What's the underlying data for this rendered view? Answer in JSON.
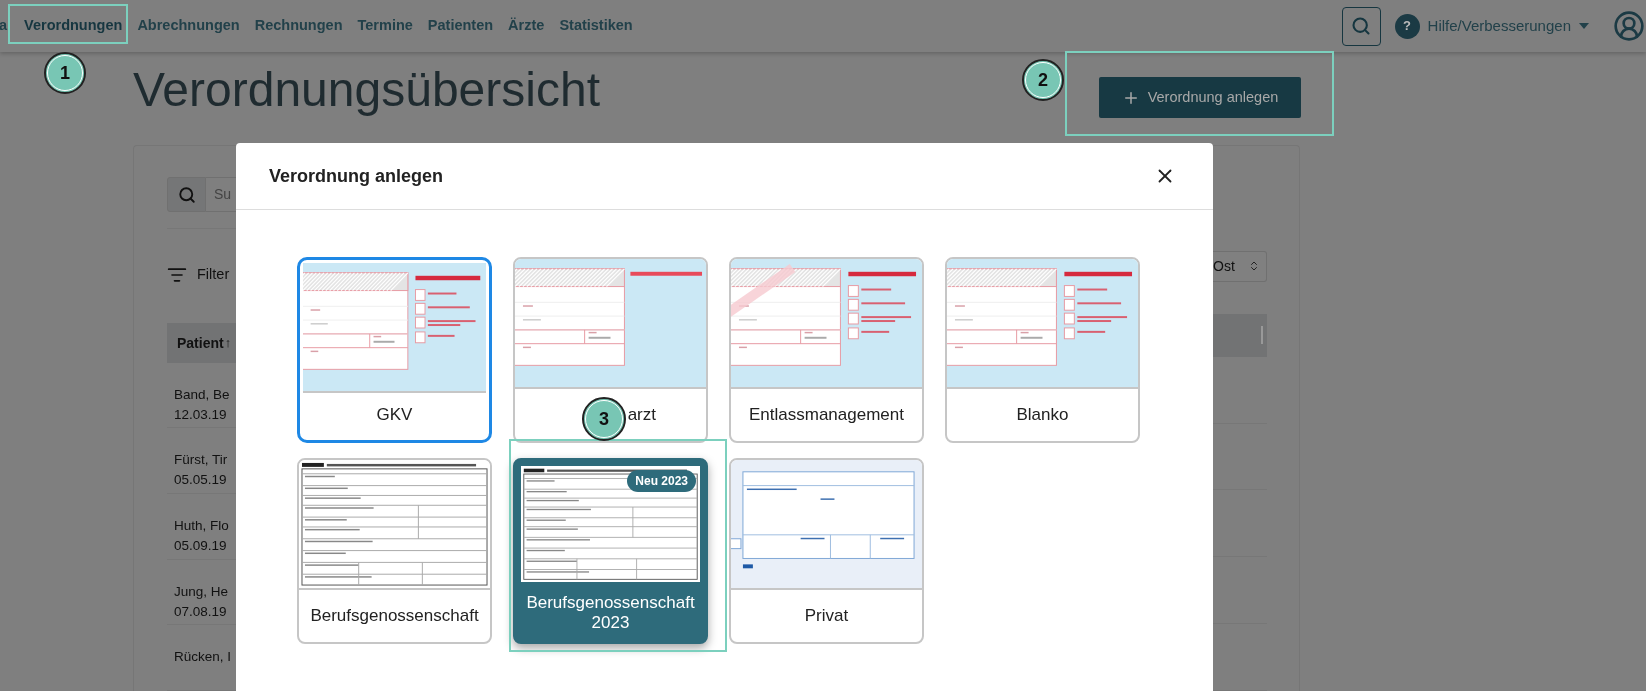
{
  "nav": {
    "items": [
      {
        "label": "a",
        "selected": false
      },
      {
        "label": "Verordnungen",
        "selected": true
      },
      {
        "label": "Abrechnungen",
        "selected": false
      },
      {
        "label": "Rechnungen",
        "selected": false
      },
      {
        "label": "Termine",
        "selected": false
      },
      {
        "label": "Patienten",
        "selected": false
      },
      {
        "label": "Ärzte",
        "selected": false
      },
      {
        "label": "Statistiken",
        "selected": false
      }
    ],
    "help": {
      "badge": "?",
      "label": "Hilfe/Verbesserungen"
    }
  },
  "page": {
    "title": "Verordnungsübersicht",
    "create_button": "Verordnung anlegen"
  },
  "search": {
    "placeholder": "Su"
  },
  "filter": {
    "label": "Filter"
  },
  "sort": {
    "value": "Ost"
  },
  "table": {
    "columns": [
      {
        "label": "Patient",
        "sort_arrow": "↑"
      }
    ],
    "rows": [
      {
        "name": "Band, Be",
        "date": "12.03.19"
      },
      {
        "name": "Fürst, Tir",
        "date": "05.05.19"
      },
      {
        "name": "Huth, Flo",
        "date": "05.09.19"
      },
      {
        "name": "Jung, He",
        "date": "07.08.19"
      },
      {
        "name": "Rücken, I"
      }
    ]
  },
  "dialog": {
    "title": "Verordnung anlegen",
    "templates": [
      {
        "label": "GKV",
        "selected": true,
        "highlighted": false,
        "thumbnail": {
          "kind": "hmv",
          "stamp": false
        }
      },
      {
        "label": "arzt",
        "selected": false,
        "highlighted": false,
        "thumbnail": {
          "kind": "zahn"
        }
      },
      {
        "label": "Entlassmanagement",
        "selected": false,
        "highlighted": false,
        "thumbnail": {
          "kind": "hmv",
          "stamp": true
        }
      },
      {
        "label": "Blanko",
        "selected": false,
        "highlighted": false,
        "thumbnail": {
          "kind": "hmv",
          "stamp": false
        }
      },
      {
        "label": "Berufsgenossenschaft",
        "selected": false,
        "highlighted": false,
        "thumbnail": {
          "kind": "bg"
        }
      },
      {
        "label": "Berufsgenossenschaft 2023",
        "selected": false,
        "highlighted": true,
        "badge": "Neu 2023",
        "thumbnail": {
          "kind": "bg"
        }
      },
      {
        "label": "Privat",
        "selected": false,
        "highlighted": false,
        "thumbnail": {
          "kind": "privat"
        }
      }
    ]
  },
  "annotations": [
    {
      "number": "1"
    },
    {
      "number": "2"
    },
    {
      "number": "3"
    }
  ]
}
